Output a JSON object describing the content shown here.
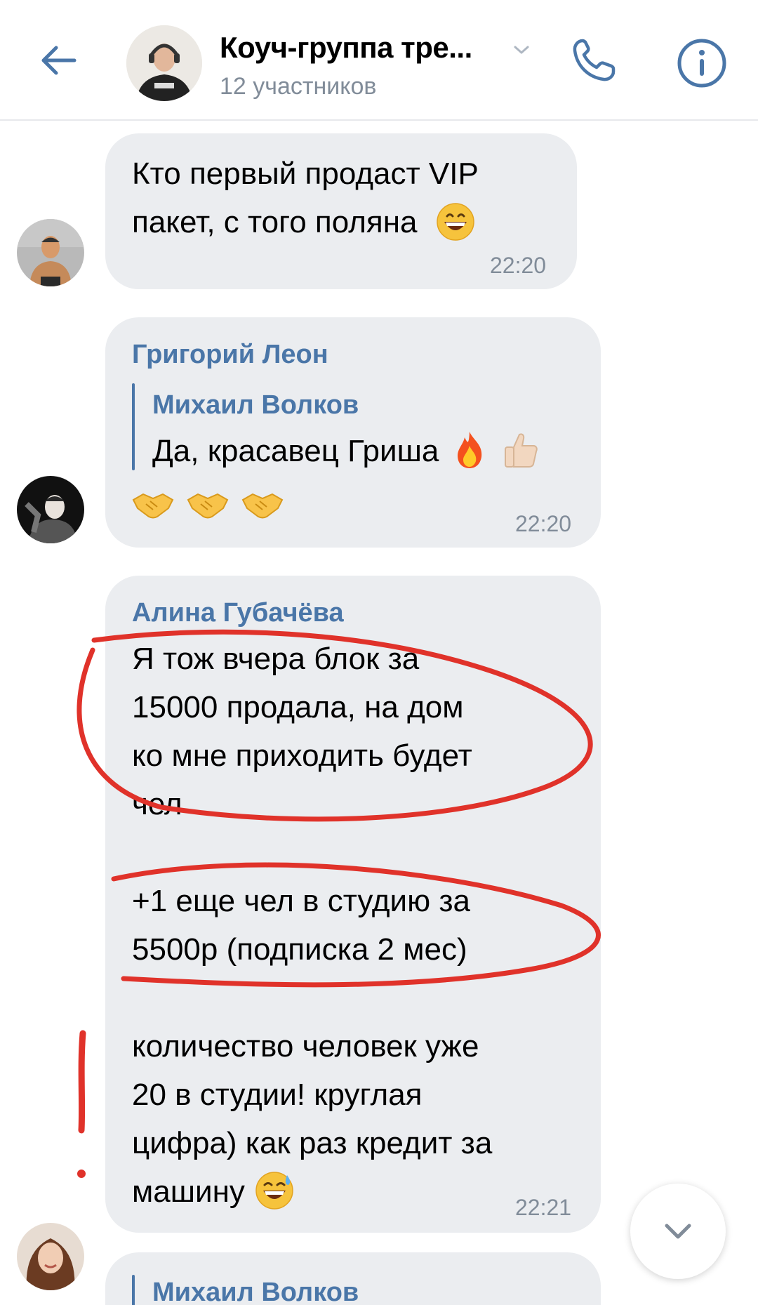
{
  "header": {
    "title": "Коуч-группа тре...",
    "subtitle": "12 участников",
    "back_icon": "arrow-left-icon",
    "call_icon": "phone-icon",
    "info_icon": "info-icon",
    "accent_color": "#4a76a8"
  },
  "messages": [
    {
      "lines": [
        "Кто первый продаст VIP",
        "пакет, с того поляна"
      ],
      "emoji": "grinning-face",
      "time": "22:20"
    },
    {
      "author": "Григорий Леон",
      "reply": {
        "author": "Михаил Волков",
        "text": "Да, красавец Гриша"
      },
      "emoji_row": [
        "handshake",
        "handshake",
        "handshake"
      ],
      "time": "22:20"
    },
    {
      "author": "Алина Губачёва",
      "paragraphs": [
        [
          "Я тож вчера блок за",
          "15000 продала, на дом",
          "ко мне приходить будет",
          "чел"
        ],
        [
          "+1 еще чел в студию за",
          "5500р (подписка 2 мес)"
        ],
        [
          "количество человек уже",
          "20 в студии! круглая",
          "цифра) как раз кредит за",
          "машину"
        ]
      ],
      "time": "22:21"
    },
    {
      "reply_author": "Михаил Волков"
    }
  ],
  "scroll_down_icon": "chevron-down-icon",
  "annotation_color": "#e0322a"
}
